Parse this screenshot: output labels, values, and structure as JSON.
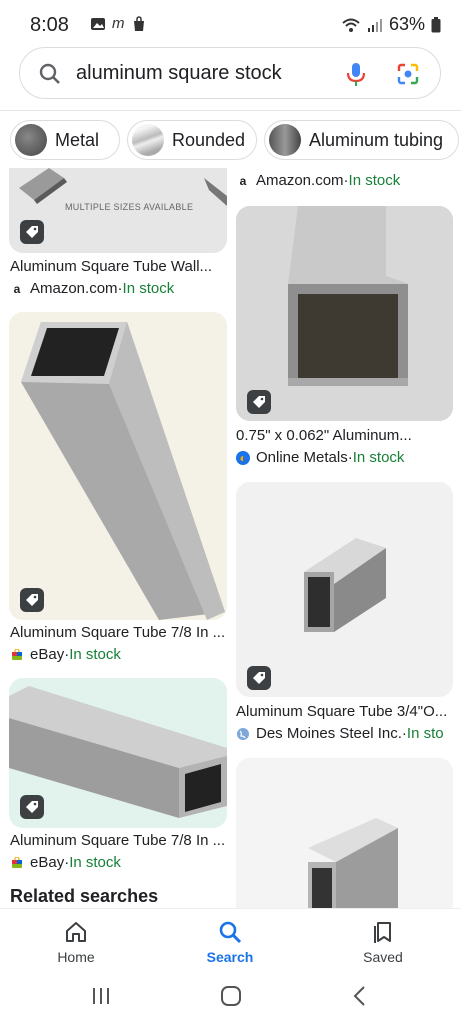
{
  "status": {
    "time": "8:08",
    "battery": "63%"
  },
  "search": {
    "query": "aluminum square stock"
  },
  "chips": [
    {
      "label": "Metal"
    },
    {
      "label": "Rounded"
    },
    {
      "label": "Aluminum tubing"
    }
  ],
  "results": {
    "r0": {
      "title": "Aluminum Square Tube Wall...",
      "source": "Amazon.com",
      "stock": "In stock",
      "caption": "MULTIPLE SIZES AVAILABLE"
    },
    "r1": {
      "source": "Amazon.com",
      "stock": "In stock"
    },
    "r2": {
      "title": "0.75\" x 0.062\" Aluminum...",
      "source": "Online Metals",
      "stock": "In stock"
    },
    "r3": {
      "title": "Aluminum Square Tube 7/8 In ...",
      "source": "eBay",
      "stock": "In stock"
    },
    "r4": {
      "title": "Aluminum Square Tube 3/4\"O...",
      "source": "Des Moines Steel Inc.",
      "stock": "In sto"
    },
    "r5": {
      "title": "Aluminum Square Tube 7/8 In ...",
      "source": "eBay",
      "stock": "In stock"
    }
  },
  "separator": " · ",
  "related": "Related searches",
  "nav": {
    "home": "Home",
    "search": "Search",
    "saved": "Saved"
  },
  "colors": {
    "accent": "#1a73e8",
    "in_stock": "#188038"
  }
}
